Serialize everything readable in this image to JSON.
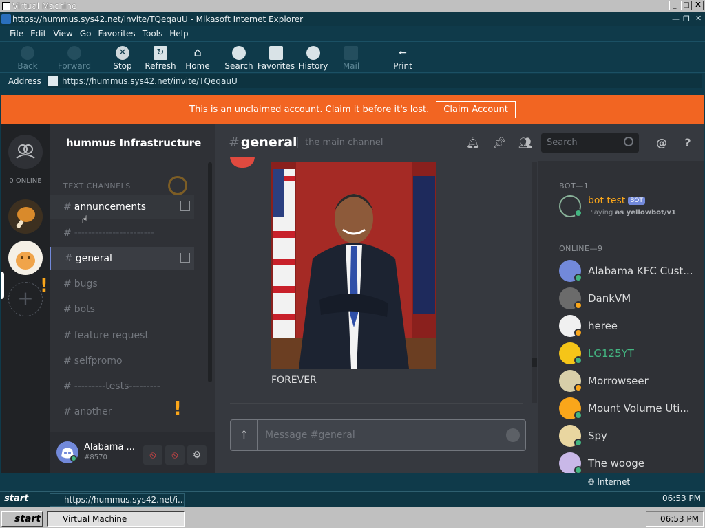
{
  "vm": {
    "title": "Virtual Machine",
    "buttons": [
      "_",
      "□",
      "X"
    ]
  },
  "browser": {
    "title": "https://hummus.sys42.net/invite/TQeqauU - Mikasoft Internet Explorer",
    "menu": [
      {
        "label": "File"
      },
      {
        "label": "Edit"
      },
      {
        "label": "View"
      },
      {
        "label": "Go"
      },
      {
        "label": "Favorites"
      },
      {
        "label": "Tools"
      },
      {
        "label": "Help"
      }
    ],
    "toolbar": {
      "back": "Back",
      "forward": "Forward",
      "stop": "Stop",
      "refresh": "Refresh",
      "home": "Home",
      "search": "Search",
      "favorites": "Favorites",
      "history": "History",
      "mail": "Mail",
      "print": "Print"
    },
    "address_label": "Address",
    "url": "https://hummus.sys42.net/invite/TQeqauU",
    "status_zone": "Internet"
  },
  "banner": {
    "message": "This is an unclaimed account. Claim it before it's lost.",
    "button": "Claim Account"
  },
  "guilds": {
    "online": "0 ONLINE",
    "add": "+"
  },
  "server": {
    "name": "hummus Infrastructure",
    "category": "TEXT CHANNELS",
    "channels": [
      {
        "name": "annuncements"
      },
      {
        "name": "-----------------------"
      },
      {
        "name": "general"
      },
      {
        "name": "bugs"
      },
      {
        "name": "bots"
      },
      {
        "name": "feature request"
      },
      {
        "name": "selfpromo"
      },
      {
        "name": "---------tests---------"
      },
      {
        "name": "another"
      }
    ]
  },
  "user": {
    "name": "Alabama ...",
    "tag": "#8570"
  },
  "chat": {
    "hash": "#",
    "channel": "general",
    "topic": "the main channel",
    "search_placeholder": "Search",
    "caption": "FOREVER",
    "input_placeholder": "Message #general",
    "mention_icon": "@",
    "help_icon": "?"
  },
  "members": {
    "bot_category": "BOT—1",
    "online_category": "ONLINE—9",
    "bot": {
      "name": "bot test",
      "badge": "BOT",
      "sub_prefix": "Playing",
      "sub_game": "as yellowbot/v1"
    },
    "list": [
      {
        "name": "Alabama KFC Cust...",
        "color": "#dcddde",
        "av": "#7289da",
        "status": "#43b581"
      },
      {
        "name": "DankVM",
        "color": "#dcddde",
        "av": "#6b6b6b",
        "status": "#faa61a"
      },
      {
        "name": "heree",
        "color": "#dcddde",
        "av": "#f0f0f0",
        "status": "#faa61a"
      },
      {
        "name": "LG125YT",
        "color": "#43b581",
        "av": "#f5c518",
        "status": "#43b581"
      },
      {
        "name": "Morrowseer",
        "color": "#dcddde",
        "av": "#d8cfa9",
        "status": "#faa61a"
      },
      {
        "name": "Mount Volume Uti...",
        "color": "#dcddde",
        "av": "#faa61a",
        "status": "#43b581"
      },
      {
        "name": "Spy",
        "color": "#dcddde",
        "av": "#e9d6a0",
        "status": "#43b581"
      },
      {
        "name": "The wooge",
        "color": "#dcddde",
        "av": "#c9b8e8",
        "status": "#43b581"
      }
    ]
  },
  "taskbar_inner": {
    "start": "start",
    "task": "https://hummus.sys42.net/i...",
    "clock": "06:53 PM"
  },
  "taskbar": {
    "start": "start",
    "task": "Virtual Machine",
    "clock": "06:53 PM"
  }
}
